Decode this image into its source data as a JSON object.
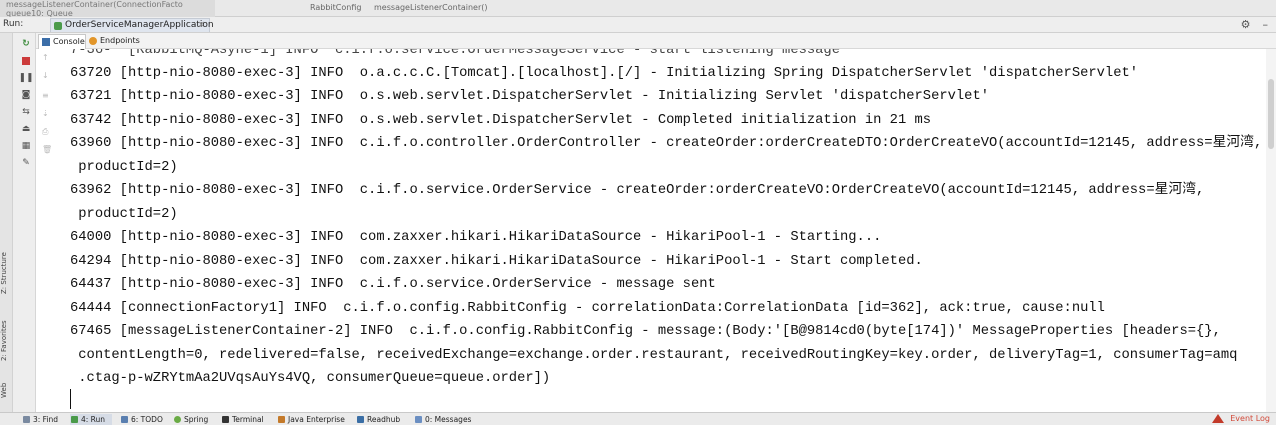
{
  "editor": {
    "ghost_tabs": [
      "messageListenerContainer(ConnectionFacto",
      "queue10: Queue"
    ],
    "breadcrumb": [
      "RabbitConfig",
      "messageListenerContainer()"
    ]
  },
  "run_panel": {
    "label": "Run:",
    "tab_title": "OrderServiceManagerApplication",
    "tab_close": "×",
    "settings_icon": "gear-icon",
    "hide_icon": "minimize-icon"
  },
  "subtabs": {
    "console": "Console",
    "endpoints": "Endpoints"
  },
  "side_labels": {
    "structure": "Z: Structure",
    "favorites": "2: Favorites",
    "web": "Web"
  },
  "console": {
    "partial_top": "7-36-  [RabbitMQ-Asyne-1] INFO  c.i.f.o.service.OrderMessageService - start listening message",
    "lines": [
      "63720 [http-nio-8080-exec-3] INFO  o.a.c.c.C.[Tomcat].[localhost].[/] - Initializing Spring DispatcherServlet 'dispatcherServlet'",
      "63721 [http-nio-8080-exec-3] INFO  o.s.web.servlet.DispatcherServlet - Initializing Servlet 'dispatcherServlet'",
      "63742 [http-nio-8080-exec-3] INFO  o.s.web.servlet.DispatcherServlet - Completed initialization in 21 ms",
      "63960 [http-nio-8080-exec-3] INFO  c.i.f.o.controller.OrderController - createOrder:orderCreateDTO:OrderCreateVO(accountId=12145, address=星河湾,",
      " productId=2)",
      "63962 [http-nio-8080-exec-3] INFO  c.i.f.o.service.OrderService - createOrder:orderCreateVO:OrderCreateVO(accountId=12145, address=星河湾,",
      " productId=2)",
      "64000 [http-nio-8080-exec-3] INFO  com.zaxxer.hikari.HikariDataSource - HikariPool-1 - Starting...",
      "64294 [http-nio-8080-exec-3] INFO  com.zaxxer.hikari.HikariDataSource - HikariPool-1 - Start completed.",
      "64437 [http-nio-8080-exec-3] INFO  c.i.f.o.service.OrderService - message sent",
      "64444 [connectionFactory1] INFO  c.i.f.o.config.RabbitConfig - correlationData:CorrelationData [id=362], ack:true, cause:null",
      "67465 [messageListenerContainer-2] INFO  c.i.f.o.config.RabbitConfig - message:(Body:'[B@9814cd0(byte[174])' MessageProperties [headers={},",
      " contentLength=0, redelivered=false, receivedExchange=exchange.order.restaurant, receivedRoutingKey=key.order, deliveryTag=1, consumerTag=amq",
      " .ctag-p-wZRYtmAa2UVqsAuYs4VQ, consumerQueue=queue.order])"
    ]
  },
  "status_bar": {
    "items": [
      "3: Find",
      "4: Run",
      "6: TODO",
      "Spring",
      "Terminal",
      "Java Enterprise",
      "Readhub",
      "0: Messages"
    ],
    "right": "Event Log"
  }
}
